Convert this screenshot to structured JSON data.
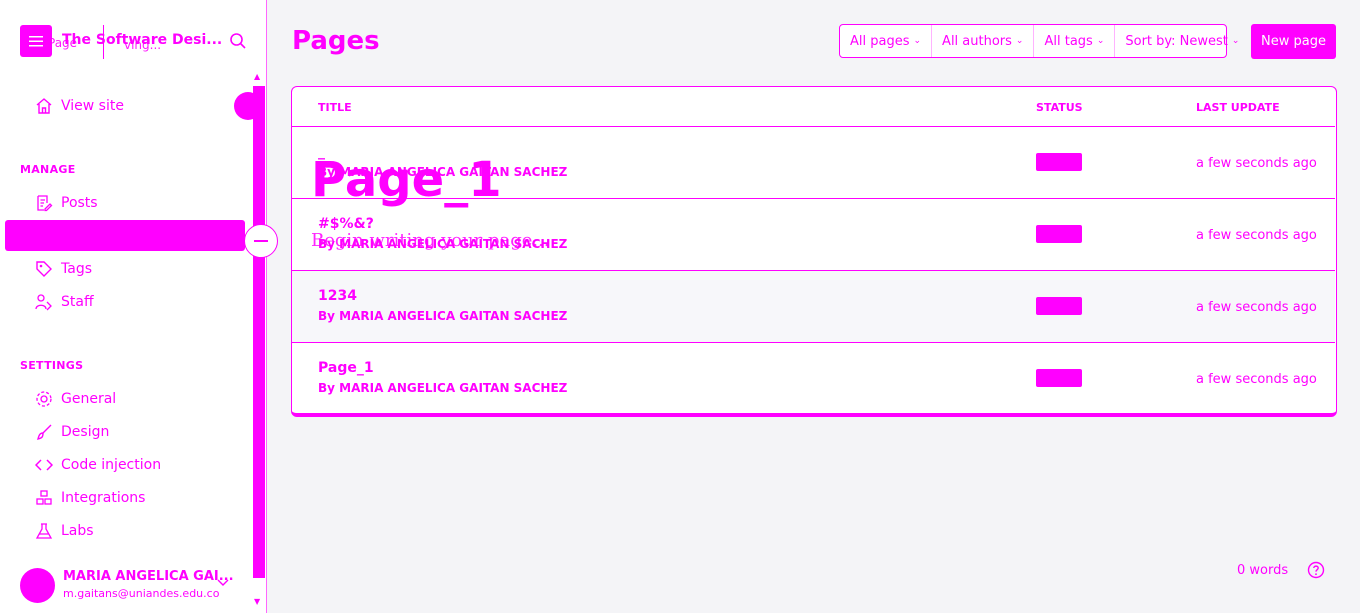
{
  "brand": {
    "name": "The Software Desi...",
    "ghost_left": "Page",
    "ghost_right": "ving..."
  },
  "nav": {
    "view_site": "View site",
    "manage_head": "MANAGE",
    "posts": "Posts",
    "tags": "Tags",
    "staff": "Staff",
    "settings_head": "SETTINGS",
    "general": "General",
    "design": "Design",
    "code_injection": "Code injection",
    "integrations": "Integrations",
    "labs": "Labs"
  },
  "user": {
    "name": "MARIA ANGELICA GAI...",
    "email": "m.gaitans@uniandes.edu.co"
  },
  "main": {
    "title": "Pages",
    "filters": [
      "All pages",
      "All authors",
      "All tags",
      "Sort by: Newest"
    ],
    "new_page": "New page",
    "columns": {
      "title": "TITLE",
      "status": "STATUS",
      "updated": "LAST UPDATE"
    },
    "rows": [
      {
        "title": "_",
        "by": "By MARIA ANGELICA GAITAN SACHEZ",
        "updated": "a few seconds ago"
      },
      {
        "title": "#$%&?",
        "by": "By MARIA ANGELICA GAITAN SACHEZ",
        "updated": "a few seconds ago"
      },
      {
        "title": "1234",
        "by": "By MARIA ANGELICA GAITAN SACHEZ",
        "updated": "a few seconds ago"
      },
      {
        "title": "Page_1",
        "by": "By MARIA ANGELICA GAITAN SACHEZ",
        "updated": "a few seconds ago"
      }
    ]
  },
  "editor_overlay": {
    "title": "Page_1",
    "placeholder": "Begin writing your page..."
  },
  "footer": {
    "words": "0 words"
  },
  "colors": {
    "accent": "#ff00ff",
    "background": "#f4f4f7"
  }
}
